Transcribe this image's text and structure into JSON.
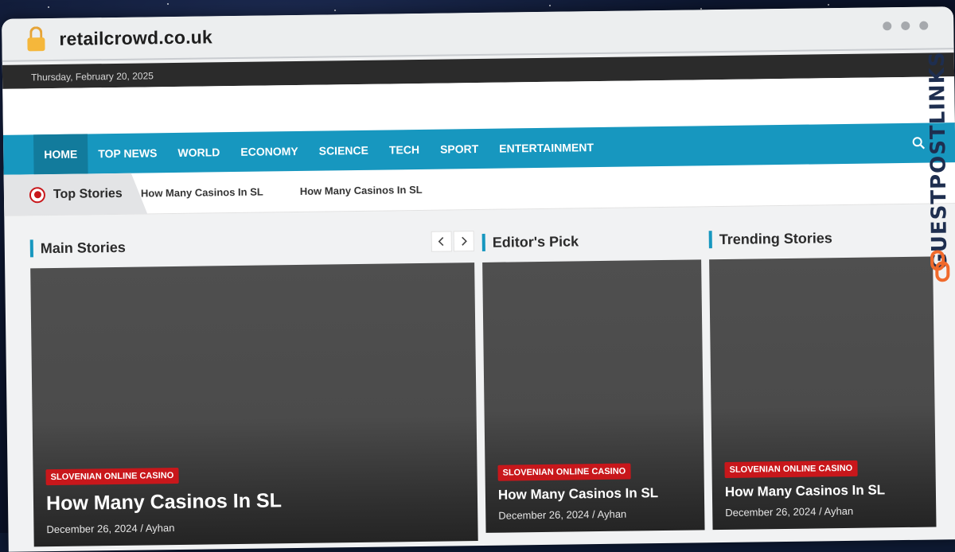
{
  "browser": {
    "url": "retailcrowd.co.uk"
  },
  "topbar": {
    "date": "Thursday, February 20, 2025"
  },
  "nav": {
    "items": [
      {
        "label": "HOME",
        "active": true
      },
      {
        "label": "TOP NEWS"
      },
      {
        "label": "WORLD"
      },
      {
        "label": "ECONOMY"
      },
      {
        "label": "SCIENCE"
      },
      {
        "label": "TECH"
      },
      {
        "label": "SPORT"
      },
      {
        "label": "ENTERTAINMENT"
      }
    ],
    "search_icon": "search-icon"
  },
  "ticker": {
    "title": "Top Stories",
    "items": [
      "How Many Casinos In SL",
      "How Many Casinos In SL"
    ]
  },
  "sections": {
    "main": {
      "title": "Main Stories",
      "card": {
        "category": "SLOVENIAN ONLINE CASINO",
        "title": "How Many Casinos In SL",
        "date": "December 26, 2024",
        "author": "Ayhan"
      }
    },
    "editor": {
      "title": "Editor's Pick",
      "card": {
        "category": "SLOVENIAN ONLINE CASINO",
        "title": "How Many Casinos In SL",
        "date": "December 26, 2024",
        "author": "Ayhan"
      }
    },
    "trending": {
      "title": "Trending Stories",
      "card": {
        "category": "SLOVENIAN ONLINE CASINO",
        "title": "How Many Casinos In SL",
        "date": "December 26, 2024",
        "author": "Ayhan"
      }
    }
  },
  "watermark": {
    "text": "GUESTPOSTLINKS"
  },
  "colors": {
    "accent": "#1797bf",
    "badge": "#c8171b",
    "topbar": "#2b2b2b"
  }
}
